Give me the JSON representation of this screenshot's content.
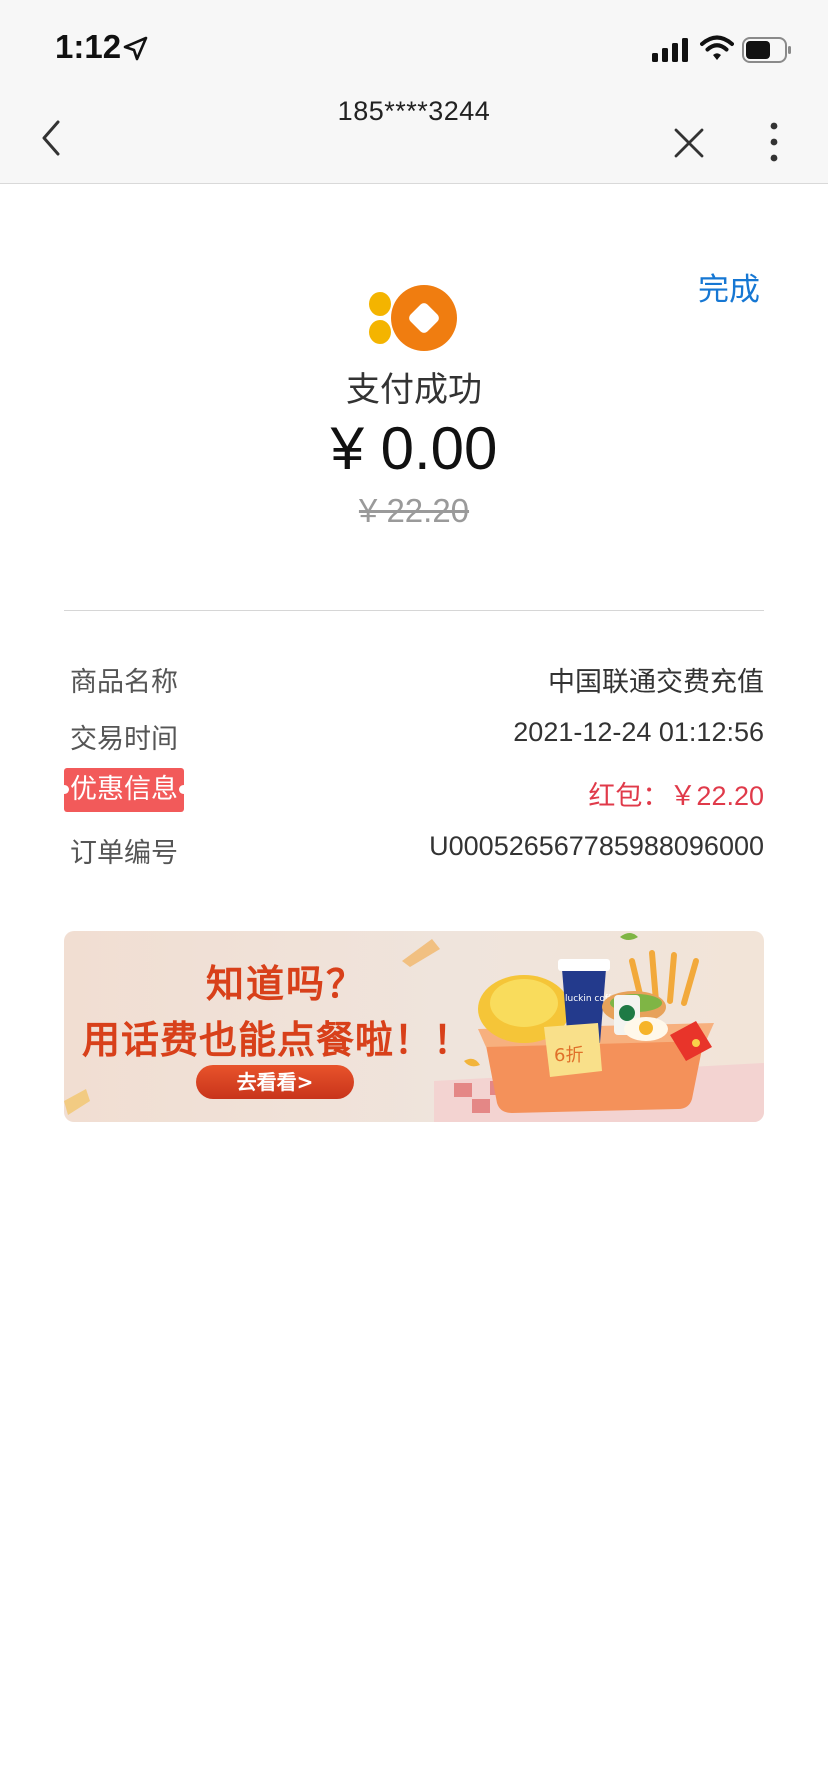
{
  "status_bar": {
    "time": "1:12"
  },
  "nav": {
    "title": "185****3244"
  },
  "header": {
    "done_label": "完成",
    "status": "支付成功",
    "amount": "¥ 0.00",
    "original_amount": "¥ 22.20"
  },
  "details": [
    {
      "label": "商品名称",
      "value": "中国联通交费充值"
    },
    {
      "label": "交易时间",
      "value": "2021-12-24 01:12:56"
    },
    {
      "label": "优惠信息",
      "value": "红包：￥22.20"
    },
    {
      "label": "订单编号",
      "value": "U000526567785988096000"
    }
  ],
  "banner": {
    "line1": "知道吗？",
    "line2": "用话费也能点餐啦！！",
    "button": "去看看>",
    "discount_badge": "6折",
    "cup_brand": "luckin coffee"
  },
  "colors": {
    "accent_blue": "#1677d3",
    "promo_red": "#f25a5a",
    "promo_value": "#e03a4a",
    "logo_orange": "#f07d10",
    "logo_yellow": "#f4b400"
  }
}
